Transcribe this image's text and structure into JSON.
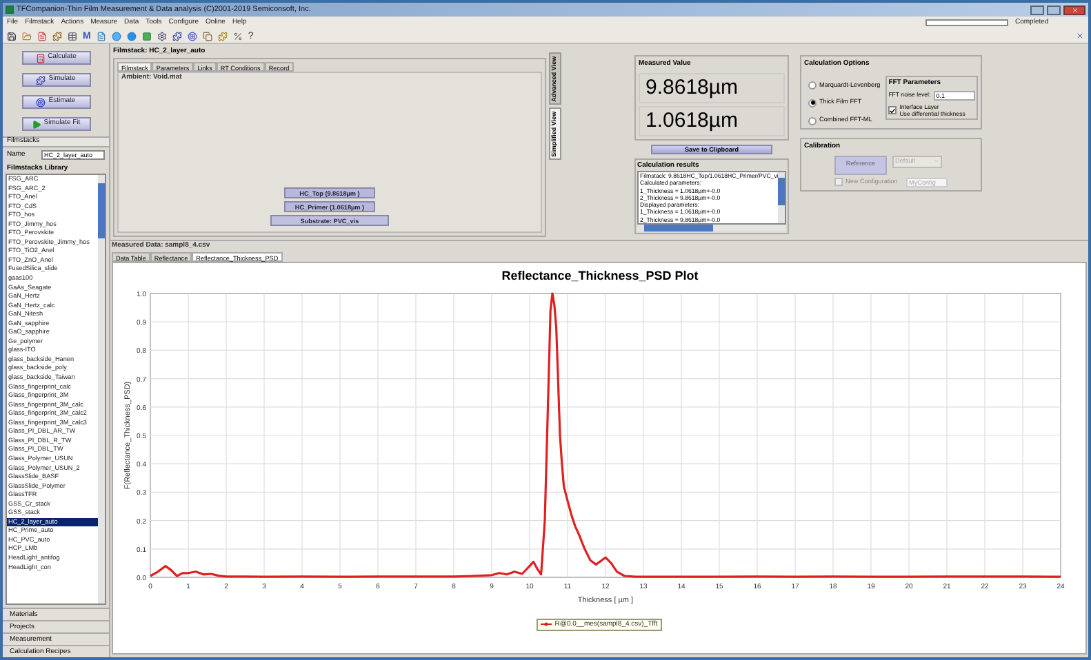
{
  "window": {
    "title": "TFCompanion-Thin Film Measurement & Data analysis (C)2001-2019 Semiconsoft, Inc."
  },
  "menu": [
    "File",
    "Filmstack",
    "Actions",
    "Measure",
    "Data",
    "Tools",
    "Configure",
    "Online",
    "Help"
  ],
  "status": {
    "text": "Completed",
    "level": 0
  },
  "toolbar": {
    "m_glyph": "M",
    "help_glyph": "?"
  },
  "actions": [
    {
      "label": "Calculate",
      "kind": "calculate"
    },
    {
      "label": "Simulate",
      "kind": "simulate"
    },
    {
      "label": "Estimate",
      "kind": "estimate"
    },
    {
      "label": "Simulate Fit",
      "kind": "fit"
    }
  ],
  "filmstacks": {
    "header": "Filmstacks",
    "name_label": "Name",
    "name_value": "HC_2_layer_auto",
    "library_title": "Filmstacks Library",
    "items": [
      {
        "label": "FSG_ARC",
        "selected": false
      },
      {
        "label": "FSG_ARC_2",
        "selected": false
      },
      {
        "label": "FTO_Anel",
        "selected": false
      },
      {
        "label": "FTO_CdS",
        "selected": false
      },
      {
        "label": "FTO_hos",
        "selected": false
      },
      {
        "label": "FTO_Jimmy_hos",
        "selected": false
      },
      {
        "label": "FTO_Perovskite",
        "selected": false
      },
      {
        "label": "FTO_Perovskite_Jimmy_hos",
        "selected": false
      },
      {
        "label": "FTO_TiO2_Anel",
        "selected": false
      },
      {
        "label": "FTO_ZnO_Anel",
        "selected": false
      },
      {
        "label": "FusedSilica_slide",
        "selected": false
      },
      {
        "label": "gaas100",
        "selected": false
      },
      {
        "label": "GaAs_Seagate",
        "selected": false
      },
      {
        "label": "GaN_Hertz",
        "selected": false
      },
      {
        "label": "GaN_Hertz_calc",
        "selected": false
      },
      {
        "label": "GaN_Nitesh",
        "selected": false
      },
      {
        "label": "GaN_sapphire",
        "selected": false
      },
      {
        "label": "GaO_sapphire",
        "selected": false
      },
      {
        "label": "Ge_polymer",
        "selected": false
      },
      {
        "label": "glass-ITO",
        "selected": false
      },
      {
        "label": "glass_backside_Hanen",
        "selected": false
      },
      {
        "label": "glass_backside_poly",
        "selected": false
      },
      {
        "label": "glass_backside_Taiwan",
        "selected": false
      },
      {
        "label": "Glass_fingerprint_calc",
        "selected": false
      },
      {
        "label": "Glass_fingerprint_3M",
        "selected": false
      },
      {
        "label": "Glass_fingerprint_3M_calc",
        "selected": false
      },
      {
        "label": "Glass_fingerprint_3M_calc2",
        "selected": false
      },
      {
        "label": "Glass_fingerprint_3M_calc3",
        "selected": false
      },
      {
        "label": "Glass_PI_DBL_AR_TW",
        "selected": false
      },
      {
        "label": "Glass_PI_DBL_R_TW",
        "selected": false
      },
      {
        "label": "Glass_PI_DBL_TW",
        "selected": false
      },
      {
        "label": "Glass_Polymer_USUN",
        "selected": false
      },
      {
        "label": "Glass_Polymer_USUN_2",
        "selected": false
      },
      {
        "label": "GlassSlide_BASF",
        "selected": false
      },
      {
        "label": "GlassSlide_Polymer",
        "selected": false
      },
      {
        "label": "GlassTFR",
        "selected": false
      },
      {
        "label": "GSS_Cr_stack",
        "selected": false
      },
      {
        "label": "GSS_stack",
        "selected": false
      },
      {
        "label": "HC_2_layer_auto",
        "selected": true
      },
      {
        "label": "HC_Prime_auto",
        "selected": false
      },
      {
        "label": "HC_PVC_auto",
        "selected": false
      },
      {
        "label": "HCP_LMb",
        "selected": false
      },
      {
        "label": "HeadLight_antifog",
        "selected": false
      },
      {
        "label": "HeadLight_con",
        "selected": false
      }
    ]
  },
  "accordion": [
    "Materials",
    "Projects",
    "Measurement",
    "Calculation Recipes"
  ],
  "filmstack_panel": {
    "title": "Filmstack: HC_2_layer_auto",
    "tabs": [
      {
        "label": "Filmstack",
        "selected": true
      },
      {
        "label": "Parameters",
        "selected": false
      },
      {
        "label": "Links",
        "selected": false
      },
      {
        "label": "RT Conditions",
        "selected": false
      },
      {
        "label": "Record",
        "selected": false
      }
    ],
    "ambient": "Ambient: Void.mat",
    "layers": [
      {
        "label": "HC_Top (9.8618µm )",
        "kind": "layer"
      },
      {
        "label": "HC_Primer (1.0618µm )",
        "kind": "layer"
      },
      {
        "label": "Substrate: PVC_vis",
        "kind": "substrate"
      }
    ]
  },
  "view_tabs": [
    {
      "label": "Advanced View",
      "selected": false
    },
    {
      "label": "Simplified View",
      "selected": true
    }
  ],
  "measured_value": {
    "title": "Measured Value",
    "values": [
      "9.8618µm",
      "1.0618µm"
    ]
  },
  "save_button": "Save to Clipboard",
  "calculation_results": {
    "title": "Calculation results",
    "lines": [
      "Filmstack: 9.8618HC_Top/1.0618HC_Primer/PVC_vi",
      "Calculated parameters:",
      "1_Thickness = 1.0618µm+-0.0",
      "2_Thickness = 9.8618µm+-0.0",
      "Displayed parameters:",
      "1_Thickness = 1.0618µm+-0.0",
      "2_Thickness = 9.8618µm+-0.0"
    ]
  },
  "calculation_options": {
    "title": "Calculation Options",
    "methods": [
      {
        "label": "Marquardt-Levenberg",
        "selected": false
      },
      {
        "label": "Thick Film FFT",
        "selected": true
      },
      {
        "label": "Combined FFT-ML",
        "selected": false
      }
    ],
    "fft": {
      "title": "FFT Parameters",
      "noise_label": "FFT noise level:",
      "noise_value": "0.1",
      "interface_lines": [
        "Interface Layer",
        "Use differential thickness"
      ],
      "checked": true
    }
  },
  "calibration": {
    "title": "Calibration",
    "reference": "Reference",
    "dropdown": "Default",
    "new_config": "New Configuration",
    "new_config_checked": false,
    "config_name": "MyConfig",
    "disabled": true
  },
  "measured_data": {
    "title": "Measured Data: sampl8_4.csv",
    "tabs": [
      {
        "label": "Data Table",
        "selected": false
      },
      {
        "label": "Reflectance",
        "selected": false
      },
      {
        "label": "Reflectance_Thickness_PSD",
        "selected": true
      }
    ],
    "chart_data": {
      "type": "line",
      "grid": true,
      "title": "Reflectance_Thickness_PSD Plot",
      "xlabel": "Thickness [ µm ]",
      "ylabel": "F(Reflectance_Thickness_PSD)",
      "x": [
        0,
        0.2,
        0.4,
        0.55,
        0.7,
        0.85,
        1,
        1.2,
        1.4,
        1.6,
        1.8,
        2,
        2.5,
        3,
        4,
        5,
        6,
        7,
        8,
        8.5,
        9,
        9.2,
        9.4,
        9.6,
        9.8,
        10,
        10.1,
        10.2,
        10.3,
        10.4,
        10.5,
        10.55,
        10.6,
        10.65,
        10.7,
        10.75,
        10.8,
        10.85,
        10.9,
        11,
        11.1,
        11.2,
        11.3,
        11.45,
        11.6,
        11.75,
        11.9,
        12,
        12.15,
        12.3,
        12.5,
        12.8,
        13,
        14,
        15,
        16,
        17,
        18,
        19,
        20,
        21,
        22,
        23,
        24
      ],
      "xlim": [
        0,
        24
      ],
      "ylim": [
        0,
        1
      ],
      "xticks": [
        0,
        1,
        2,
        3,
        4,
        5,
        6,
        7,
        8,
        9,
        10,
        11,
        12,
        13,
        14,
        15,
        16,
        17,
        18,
        19,
        20,
        21,
        22,
        23,
        24
      ],
      "yticks": [
        {
          "value": 0,
          "label": "0.0"
        },
        {
          "value": 0.1,
          "label": "0.1"
        },
        {
          "value": 0.2,
          "label": "0.2"
        },
        {
          "value": 0.3,
          "label": "0.3"
        },
        {
          "value": 0.4,
          "label": "0.4"
        },
        {
          "value": 0.5,
          "label": "0.5"
        },
        {
          "value": 0.6,
          "label": "0.6"
        },
        {
          "value": 0.7,
          "label": "0.7"
        },
        {
          "value": 0.8,
          "label": "0.8"
        },
        {
          "value": 0.9,
          "label": "0.9"
        },
        {
          "value": 1,
          "label": "1.0"
        }
      ],
      "series": [
        {
          "name": "R@0.0__mes(sampl8_4.csv)_Tfft",
          "color": "#e02020",
          "values": [
            0.005,
            0.02,
            0.04,
            0.025,
            0.005,
            0.015,
            0.015,
            0.02,
            0.01,
            0.012,
            0.006,
            0.003,
            0.003,
            0.002,
            0.003,
            0.002,
            0.003,
            0.003,
            0.003,
            0.005,
            0.008,
            0.015,
            0.01,
            0.02,
            0.012,
            0.04,
            0.055,
            0.03,
            0.01,
            0.2,
            0.7,
            0.94,
            1.0,
            0.96,
            0.88,
            0.7,
            0.5,
            0.4,
            0.32,
            0.27,
            0.22,
            0.18,
            0.15,
            0.1,
            0.06,
            0.045,
            0.06,
            0.07,
            0.05,
            0.02,
            0.005,
            0.002,
            0.002,
            0.002,
            0.002,
            0.003,
            0.002,
            0.003,
            0.002,
            0.002,
            0.003,
            0.003,
            0.003,
            0.002
          ]
        }
      ]
    }
  }
}
